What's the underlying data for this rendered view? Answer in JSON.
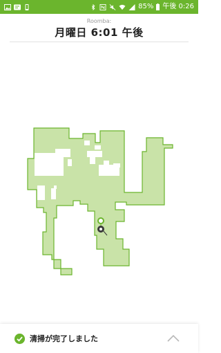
{
  "status_bar": {
    "battery": "85%",
    "time": "午後 0:26",
    "left_icons": [
      "gallery-icon",
      "app-icon",
      "phone-icon"
    ],
    "right_icons": [
      "bluetooth-icon",
      "nfc-icon",
      "mute-icon",
      "wifi-icon",
      "signal-icon",
      "battery-icon"
    ]
  },
  "header": {
    "subtitle": "Roomba:",
    "title": "月曜日 6:01 午後"
  },
  "map": {
    "fill_color": "#c9e3a8",
    "border_color": "#6bb52d"
  },
  "footer": {
    "status": "清掃が完了しました"
  },
  "colors": {
    "accent": "#6bb52d"
  }
}
